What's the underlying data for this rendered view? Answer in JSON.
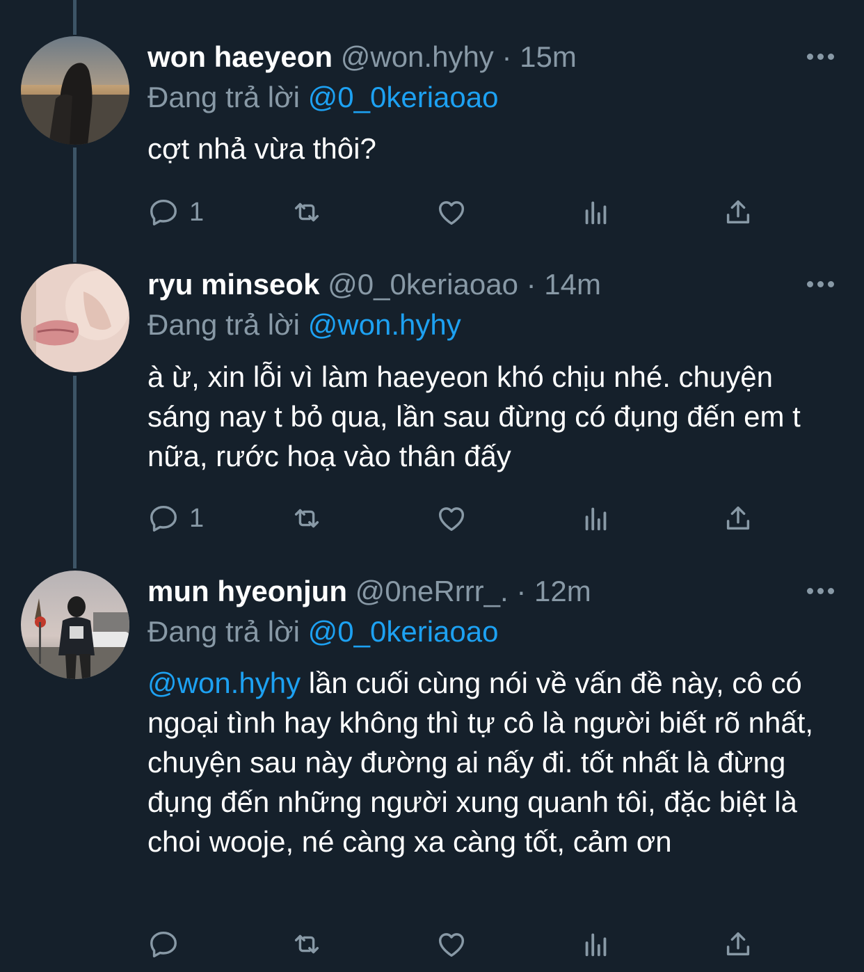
{
  "tweets": [
    {
      "display_name": "won haeyeon",
      "handle": "@won.hyhy",
      "separator": "·",
      "time": "15m",
      "replying_label": "Đang trả lời",
      "replying_to": "@0_0keriaoao",
      "body_mention": "",
      "body": "cợt nhả vừa thôi?",
      "reply_count": "1",
      "avatar_icon": "avatar-sunset-photo"
    },
    {
      "display_name": "ryu minseok",
      "handle": "@0_0keriaoao",
      "separator": "·",
      "time": "14m",
      "replying_label": "Đang trả lời",
      "replying_to": "@won.hyhy",
      "body_mention": "",
      "body": "à ừ, xin lỗi vì làm haeyeon khó chịu nhé. chuyện sáng nay t bỏ qua, lần sau đừng có đụng đến em t nữa, rước hoạ vào thân đấy",
      "reply_count": "1",
      "avatar_icon": "avatar-face-closeup"
    },
    {
      "display_name": "mun hyeonjun",
      "handle": "@0neRrrr_.",
      "separator": "·",
      "time": "12m",
      "replying_label": "Đang trả lời",
      "replying_to": "@0_0keriaoao",
      "body_mention": "@won.hyhy",
      "body": " lần cuối cùng nói về vấn đề này, cô có ngoại tình hay không thì tự cô là người biết rõ nhất, chuyện sau này đường ai nấy đi. tốt nhất là đừng đụng đến những người xung quanh tôi, đặc biệt là choi wooje, né càng xa càng tốt, cảm ơn",
      "reply_count": "",
      "avatar_icon": "avatar-street-photo"
    }
  ],
  "colors": {
    "background": "#15202b",
    "secondary_text": "#8899a6",
    "accent": "#1da1f2",
    "thread_line": "#3d5466"
  },
  "action_icons": [
    "reply-icon",
    "retweet-icon",
    "like-icon",
    "analytics-icon",
    "share-icon"
  ]
}
